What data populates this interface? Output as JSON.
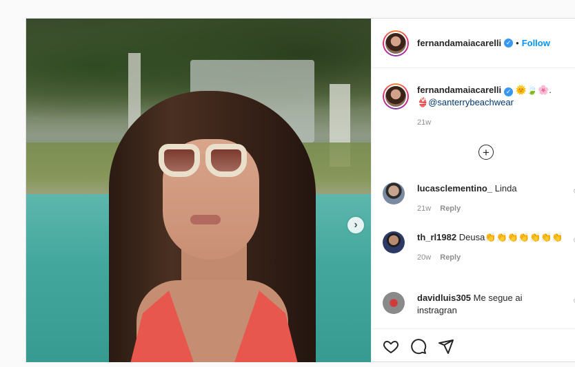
{
  "post": {
    "author": "fernandamaiacarelli",
    "follow_label": "Follow",
    "separator": "•",
    "verified_glyph": "✓",
    "more_icon": "plus-circle-icon",
    "next_icon": "chevron-right-icon"
  },
  "caption": {
    "username": "fernandamaiacarelli",
    "emojis": "🌞🍃🌸.",
    "bikini_emoji": "👙",
    "mention": "@santerrybeachwear",
    "time": "21w"
  },
  "comments": [
    {
      "username": "lucasclementino_",
      "text": "Linda",
      "time": "21w",
      "reply_label": "Reply",
      "avatar_color": "#7a8aa0"
    },
    {
      "username": "th_rl1982",
      "text": "Deusa👏👏👏👏👏👏👏",
      "time": "20w",
      "reply_label": "Reply",
      "avatar_color": "#2d3a66"
    },
    {
      "username": "davidluis305",
      "text": "Me segue ai instragran",
      "time": "",
      "reply_label": "",
      "avatar_color": "#8a8a8a"
    }
  ],
  "actions": {
    "like_icon": "heart-icon",
    "comment_icon": "comment-icon",
    "share_icon": "send-icon"
  },
  "colors": {
    "accent": "#0095f6",
    "verified": "#3897f0",
    "mention": "#00376b",
    "bikini": "#e8574d",
    "pool": "#43a79d"
  }
}
